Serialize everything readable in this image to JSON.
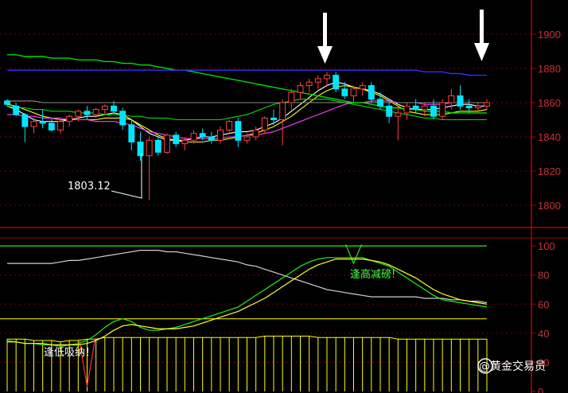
{
  "colors": {
    "background": "#000000",
    "frame": "#b40000",
    "grid": "#7a0000",
    "axis_text": "#c83232",
    "candle_up": "#ff4040",
    "candle_down": "#00e5ff",
    "ma_short": "#ffffff",
    "ma_yellow": "#ffff00",
    "ma_magenta": "#ff40ff",
    "ma_green": "#00dd00",
    "ma_gray": "#8c8c8c",
    "ma_long_green": "#00dd00",
    "ma_long_blue": "#3030ff",
    "ind_white": "#d0d0d0",
    "ind_green": "#22ee22",
    "ind_yellow": "#ffff30",
    "ind_bar": "#ffff00",
    "ind_dip": "#ff3030",
    "annot_text": "#ffffff",
    "annot_green": "#44ff44"
  },
  "annotations": {
    "low_label": "1803.12",
    "signal_high": "逢高减磅!",
    "signal_low": "逢低吸纳！",
    "watermark": "@黄金交易员",
    "arrow_icon": "down-arrow-icon"
  },
  "chart_data": [
    {
      "type": "candlestick",
      "title": "",
      "xlabel": "",
      "ylabel": "",
      "ylim": [
        1787,
        1920
      ],
      "yticks": [
        1800,
        1820,
        1840,
        1860,
        1880,
        1900
      ],
      "grid": true,
      "candles": [
        [
          1861,
          1862,
          1858,
          1859
        ],
        [
          1858,
          1860,
          1852,
          1853
        ],
        [
          1853,
          1854,
          1837,
          1846
        ],
        [
          1846,
          1851,
          1842,
          1849
        ],
        [
          1849,
          1856,
          1845,
          1848
        ],
        [
          1848,
          1851,
          1843,
          1844
        ],
        [
          1844,
          1850,
          1842,
          1849
        ],
        [
          1849,
          1853,
          1846,
          1852
        ],
        [
          1852,
          1856,
          1849,
          1855
        ],
        [
          1855,
          1858,
          1850,
          1853
        ],
        [
          1853,
          1857,
          1851,
          1856
        ],
        [
          1856,
          1859,
          1853,
          1858
        ],
        [
          1858,
          1861,
          1854,
          1855
        ],
        [
          1855,
          1857,
          1844,
          1847
        ],
        [
          1847,
          1850,
          1832,
          1837
        ],
        [
          1837,
          1843,
          1826,
          1829
        ],
        [
          1829,
          1840,
          1803.12,
          1838
        ],
        [
          1838,
          1840,
          1829,
          1831
        ],
        [
          1831,
          1842,
          1830,
          1841
        ],
        [
          1841,
          1843,
          1834,
          1836
        ],
        [
          1836,
          1840,
          1832,
          1838
        ],
        [
          1838,
          1844,
          1836,
          1842
        ],
        [
          1842,
          1845,
          1838,
          1840
        ],
        [
          1840,
          1843,
          1836,
          1838
        ],
        [
          1838,
          1846,
          1836,
          1844
        ],
        [
          1844,
          1850,
          1842,
          1849
        ],
        [
          1849,
          1851,
          1834,
          1838
        ],
        [
          1838,
          1842,
          1836,
          1840
        ],
        [
          1840,
          1846,
          1838,
          1844
        ],
        [
          1844,
          1852,
          1842,
          1851
        ],
        [
          1851,
          1856,
          1847,
          1850
        ],
        [
          1850,
          1862,
          1835,
          1860
        ],
        [
          1860,
          1868,
          1856,
          1866
        ],
        [
          1866,
          1872,
          1862,
          1870
        ],
        [
          1870,
          1874,
          1866,
          1872
        ],
        [
          1872,
          1876,
          1868,
          1874
        ],
        [
          1874,
          1878,
          1870,
          1876
        ],
        [
          1876,
          1878,
          1866,
          1868
        ],
        [
          1868,
          1872,
          1862,
          1864
        ],
        [
          1864,
          1870,
          1860,
          1868
        ],
        [
          1868,
          1872,
          1864,
          1870
        ],
        [
          1870,
          1872,
          1860,
          1862
        ],
        [
          1862,
          1866,
          1856,
          1858
        ],
        [
          1858,
          1862,
          1848,
          1852
        ],
        [
          1852,
          1858,
          1838,
          1854
        ],
        [
          1854,
          1860,
          1850,
          1858
        ],
        [
          1858,
          1862,
          1854,
          1856
        ],
        [
          1856,
          1860,
          1852,
          1858
        ],
        [
          1858,
          1862,
          1850,
          1852
        ],
        [
          1852,
          1862,
          1850,
          1860
        ],
        [
          1860,
          1868,
          1856,
          1864
        ],
        [
          1864,
          1870,
          1856,
          1858
        ],
        [
          1858,
          1862,
          1854,
          1857
        ],
        [
          1857,
          1860,
          1854,
          1858
        ],
        [
          1858,
          1862,
          1856,
          1860
        ]
      ],
      "series": [
        {
          "values": [
            1858,
            1856,
            1853,
            1850,
            1849,
            1849,
            1849,
            1850,
            1851,
            1852,
            1852,
            1853,
            1854,
            1853,
            1850,
            1846,
            1842,
            1840,
            1838,
            1838,
            1838,
            1839,
            1840,
            1840,
            1841,
            1842,
            1843,
            1843,
            1844,
            1846,
            1848,
            1851,
            1855,
            1859,
            1863,
            1867,
            1870,
            1872,
            1871,
            1869,
            1868,
            1867,
            1865,
            1862,
            1859,
            1857,
            1856,
            1856,
            1856,
            1857,
            1858,
            1859,
            1859,
            1858,
            1858
          ]
        },
        {
          "values": [
            1859,
            1858,
            1856,
            1854,
            1852,
            1851,
            1850,
            1850,
            1850,
            1850,
            1850,
            1851,
            1851,
            1851,
            1850,
            1847,
            1844,
            1841,
            1839,
            1838,
            1837,
            1837,
            1837,
            1838,
            1838,
            1839,
            1840,
            1841,
            1842,
            1844,
            1846,
            1849,
            1852,
            1856,
            1860,
            1864,
            1867,
            1869,
            1870,
            1869,
            1868,
            1866,
            1864,
            1861,
            1858,
            1855,
            1854,
            1853,
            1853,
            1853,
            1854,
            1855,
            1855,
            1855,
            1856
          ]
        },
        {
          "values": [
            1853,
            1853,
            1852,
            1852,
            1851,
            1851,
            1851,
            1850,
            1850,
            1850,
            1849,
            1849,
            1849,
            1848,
            1847,
            1845,
            1843,
            1842,
            1841,
            1840,
            1839,
            1839,
            1839,
            1839,
            1839,
            1840,
            1840,
            1841,
            1841,
            1842,
            1843,
            1845,
            1847,
            1849,
            1851,
            1853,
            1855,
            1857,
            1859,
            1860,
            1860,
            1861,
            1861,
            1861,
            1860,
            1860,
            1860,
            1859,
            1859,
            1859,
            1860,
            1860,
            1860,
            1860,
            1860
          ]
        },
        {
          "values": [
            1858,
            1857,
            1857,
            1856,
            1856,
            1855,
            1855,
            1855,
            1854,
            1854,
            1854,
            1853,
            1853,
            1853,
            1852,
            1852,
            1851,
            1851,
            1851,
            1850,
            1850,
            1850,
            1850,
            1850,
            1850,
            1851,
            1852,
            1853,
            1855,
            1857,
            1859,
            1860,
            1861,
            1862,
            1862,
            1862,
            1862,
            1861,
            1860,
            1859,
            1858,
            1857,
            1856,
            1855,
            1854,
            1853,
            1852,
            1851,
            1851,
            1850,
            1850,
            1850,
            1850,
            1850,
            1850
          ]
        },
        {
          "values": [
            1861,
            1861,
            1861,
            1861,
            1860,
            1860,
            1860,
            1860,
            1860,
            1860,
            1860,
            1860,
            1860,
            1860,
            1860,
            1860,
            1860,
            1860,
            1860,
            1860,
            1860,
            1860,
            1860,
            1860,
            1860,
            1860,
            1860,
            1860,
            1860,
            1860,
            1860,
            1860,
            1860,
            1860,
            1860,
            1860,
            1860,
            1860,
            1860,
            1860,
            1860,
            1860,
            1860,
            1860,
            1860,
            1860,
            1860,
            1860,
            1860,
            1860,
            1860,
            1860,
            1860,
            1860,
            1860
          ]
        },
        {
          "values": [
            1888,
            1888,
            1887,
            1887,
            1887,
            1886,
            1886,
            1886,
            1885,
            1885,
            1885,
            1884,
            1884,
            1883,
            1883,
            1882,
            1882,
            1881,
            1880,
            1879,
            1879,
            1878,
            1877,
            1876,
            1875,
            1874,
            1873,
            1872,
            1871,
            1870,
            1869,
            1868,
            1867,
            1866,
            1865,
            1864,
            1863,
            1862,
            1861,
            1860,
            1860,
            1859,
            1858,
            1857,
            1857,
            1856,
            1856,
            1855,
            1855,
            1855,
            1854,
            1854,
            1854,
            1854,
            1854
          ]
        },
        {
          "values": [
            1879,
            1879,
            1879,
            1879,
            1879,
            1879,
            1879,
            1879,
            1879,
            1879,
            1879,
            1879,
            1879,
            1879,
            1879,
            1879,
            1879,
            1879,
            1879,
            1879,
            1879,
            1879,
            1879,
            1879,
            1879,
            1879,
            1879,
            1879,
            1879,
            1879,
            1879,
            1879,
            1879,
            1879,
            1879,
            1879,
            1879,
            1879,
            1879,
            1879,
            1879,
            1879,
            1879,
            1879,
            1879,
            1879,
            1879,
            1878,
            1878,
            1878,
            1877,
            1877,
            1876,
            1876,
            1876
          ]
        }
      ]
    },
    {
      "type": "line",
      "title": "",
      "ylim": [
        0,
        105
      ],
      "yticks": [
        0,
        20,
        40,
        60,
        80,
        100
      ],
      "hlines": [
        100,
        28
      ],
      "series": [
        {
          "values": [
            88,
            88,
            88,
            88,
            88,
            88,
            89,
            90,
            90,
            91,
            92,
            93,
            94,
            95,
            96,
            97,
            97,
            97,
            96,
            96,
            95,
            94,
            93,
            92,
            91,
            90,
            89,
            87,
            86,
            84,
            82,
            80,
            78,
            76,
            74,
            72,
            70,
            69,
            68,
            67,
            66,
            65,
            65,
            65,
            65,
            65,
            65,
            64,
            64,
            64,
            63,
            63,
            62,
            62,
            61
          ]
        },
        {
          "values": [
            35,
            34,
            33,
            33,
            32,
            32,
            31,
            32,
            33,
            35,
            39,
            44,
            48,
            50,
            48,
            44,
            42,
            42,
            43,
            44,
            46,
            48,
            50,
            52,
            54,
            56,
            58,
            62,
            66,
            70,
            74,
            78,
            82,
            86,
            89,
            91,
            92,
            92,
            92,
            92,
            92,
            90,
            88,
            86,
            82,
            78,
            74,
            70,
            66,
            63,
            62,
            61,
            60,
            59,
            58
          ]
        },
        {
          "values": [
            34,
            34,
            33,
            33,
            33,
            32,
            32,
            32,
            32,
            33,
            35,
            38,
            42,
            45,
            46,
            45,
            44,
            43,
            43,
            43,
            44,
            45,
            47,
            49,
            51,
            53,
            55,
            58,
            61,
            64,
            68,
            72,
            76,
            80,
            84,
            87,
            89,
            91,
            91,
            91,
            91,
            90,
            89,
            87,
            84,
            81,
            78,
            74,
            70,
            67,
            65,
            63,
            62,
            61,
            60
          ]
        },
        {
          "values": [
            36,
            36,
            36,
            35,
            35,
            35,
            34,
            35,
            35,
            36,
            36,
            37,
            37,
            37,
            37,
            37,
            37,
            37,
            37,
            37,
            37,
            37,
            37,
            37,
            37,
            37,
            37,
            37,
            37,
            38,
            38,
            38,
            38,
            38,
            38,
            37,
            37,
            37,
            37,
            37,
            37,
            37,
            37,
            37,
            36,
            36,
            36,
            36,
            36,
            36,
            36,
            36,
            36,
            36,
            36
          ]
        }
      ]
    }
  ]
}
